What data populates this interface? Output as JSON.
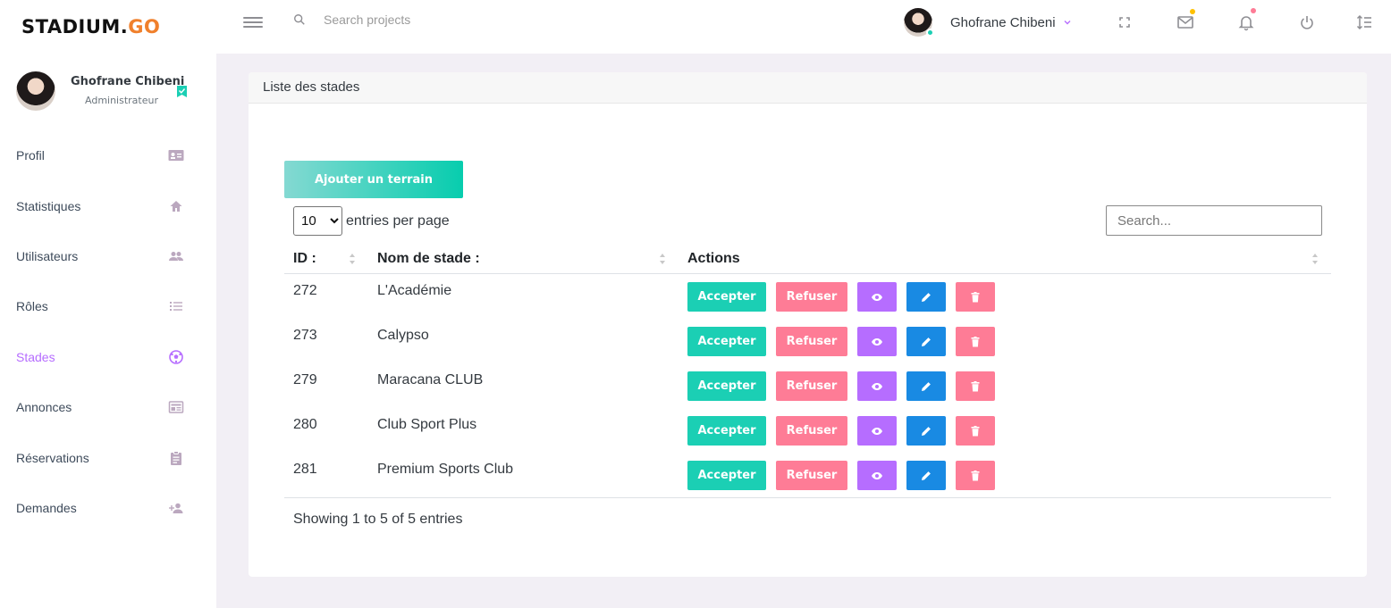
{
  "brand": {
    "name_main": "STADIUM.",
    "name_accent": "GO",
    "accent_color": "#f0802c"
  },
  "topbar": {
    "search_placeholder": "Search projects",
    "user_name": "Ghofrane Chibeni",
    "icons": [
      "menu-icon",
      "search-icon",
      "fullscreen-icon",
      "mail-icon",
      "bell-icon",
      "power-icon",
      "format-line-spacing-icon"
    ]
  },
  "sidebar": {
    "profile": {
      "name": "Ghofrane Chibeni",
      "role": "Administrateur"
    },
    "items": [
      {
        "label": "Profil",
        "icon": "id-card-icon",
        "active": false
      },
      {
        "label": "Statistiques",
        "icon": "home-icon",
        "active": false
      },
      {
        "label": "Utilisateurs",
        "icon": "users-icon",
        "active": false
      },
      {
        "label": "Rôles",
        "icon": "list-icon",
        "active": false
      },
      {
        "label": "Stades",
        "icon": "soccer-ball-icon",
        "active": true
      },
      {
        "label": "Annonces",
        "icon": "newspaper-icon",
        "active": false
      },
      {
        "label": "Réservations",
        "icon": "clipboard-icon",
        "active": false
      },
      {
        "label": "Demandes",
        "icon": "user-plus-icon",
        "active": false
      }
    ]
  },
  "card": {
    "title": "Liste des stades",
    "add_button": "Ajouter un terrain",
    "page_length": "10",
    "page_length_options": [
      "10"
    ],
    "entries_label": "entries per page",
    "search_placeholder": "Search...",
    "columns": [
      "ID :",
      "Nom de stade :",
      "Actions"
    ],
    "rows": [
      {
        "id": "272",
        "name": "L'Académie"
      },
      {
        "id": "273",
        "name": "Calypso"
      },
      {
        "id": "279",
        "name": "Maracana CLUB"
      },
      {
        "id": "280",
        "name": "Club Sport Plus"
      },
      {
        "id": "281",
        "name": "Premium Sports Club"
      }
    ],
    "actions": {
      "accept": "Accepter",
      "refuse": "Refuser"
    },
    "info": "Showing 1 to 5 of 5 entries"
  },
  "colors": {
    "accent_purple": "#b66dff",
    "success": "#1bcfb4",
    "danger": "#fe7c96",
    "info": "#198ae3"
  }
}
